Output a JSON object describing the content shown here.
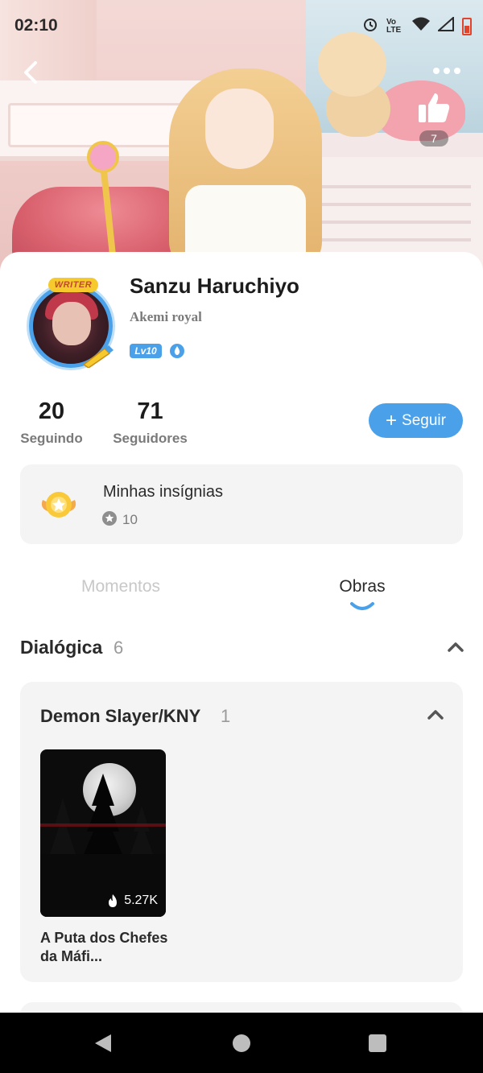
{
  "status_bar": {
    "time": "02:10",
    "icons": [
      "alarm-icon",
      "volte-icon",
      "wifi-icon",
      "signal-icon",
      "battery-icon"
    ],
    "volte_text": "Vo LTE"
  },
  "header": {
    "back_icon": "chevron-left-icon",
    "more_icon": "more-dots-icon",
    "like_icon": "thumbs-up-icon",
    "like_count": "7"
  },
  "profile": {
    "avatar_badge": "WRITER",
    "name": "Sanzu Haruchiyo",
    "subtitle": "Akemi royal",
    "level": "Lv10",
    "verify_icon": "water-drop-badge-icon"
  },
  "stats": [
    {
      "value": "20",
      "label": "Seguindo"
    },
    {
      "value": "71",
      "label": "Seguidores"
    }
  ],
  "follow_button": {
    "icon": "plus-icon",
    "label": "Seguir"
  },
  "badges": {
    "title": "Minhas insígnias",
    "count": "10",
    "medal_icon": "medal-icon",
    "count_icon": "star-circle-icon"
  },
  "tabs": [
    {
      "label": "Momentos",
      "active": false
    },
    {
      "label": "Obras",
      "active": true
    }
  ],
  "section": {
    "title": "Dialógica",
    "count": "6",
    "groups": [
      {
        "title": "Demon Slayer/KNY",
        "count": "1",
        "works": [
          {
            "title": "A Puta dos Chefes da Máfi...",
            "views": "5.27K",
            "views_icon": "flame-icon"
          }
        ]
      }
    ]
  },
  "colors": {
    "accent": "#4aa1ea",
    "text_primary": "#1c1c1c",
    "text_secondary": "#7a7a7a",
    "card_bg": "#f4f4f4"
  },
  "nav_bar": {
    "icons": [
      "nav-back-icon",
      "nav-home-icon",
      "nav-recents-icon"
    ]
  }
}
